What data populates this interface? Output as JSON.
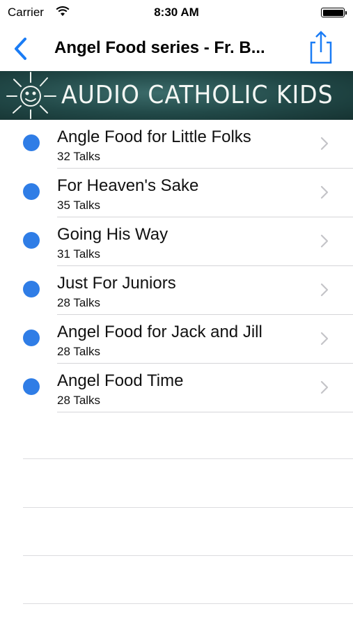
{
  "status_bar": {
    "carrier": "Carrier",
    "time": "8:30 AM",
    "wifi_icon": "wifi-icon",
    "battery_icon": "battery-icon"
  },
  "nav": {
    "title": "Angel Food series - Fr. B...",
    "back_icon": "chevron-left-icon",
    "share_icon": "share-icon",
    "accent_color": "#1a7cf5"
  },
  "banner": {
    "text": "AUDIO CATHOLIC KIDS",
    "logo_icon": "sun-icon"
  },
  "list": {
    "items": [
      {
        "title": "Angle Food for Little Folks",
        "subtitle": "32 Talks"
      },
      {
        "title": "For Heaven's Sake",
        "subtitle": "35 Talks"
      },
      {
        "title": "Going His Way",
        "subtitle": "31 Talks"
      },
      {
        "title": "Just For Juniors",
        "subtitle": "28 Talks"
      },
      {
        "title": "Angel Food for Jack and Jill",
        "subtitle": "28 Talks"
      },
      {
        "title": "Angel Food Time",
        "subtitle": "28 Talks"
      }
    ],
    "dot_color": "#2f7de6",
    "disclosure_icon": "chevron-right-icon"
  }
}
